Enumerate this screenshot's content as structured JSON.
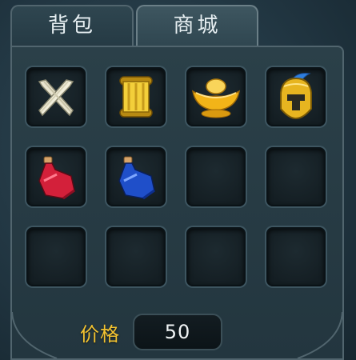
{
  "tabs": [
    {
      "label": "背包",
      "active": false
    },
    {
      "label": "商城",
      "active": true
    }
  ],
  "grid": {
    "slots": [
      {
        "item": "crossed-swords-icon"
      },
      {
        "item": "scroll-icon"
      },
      {
        "item": "gold-ingot-icon"
      },
      {
        "item": "helmet-icon"
      },
      {
        "item": "red-potion-icon"
      },
      {
        "item": "blue-potion-icon"
      },
      {
        "item": ""
      },
      {
        "item": ""
      },
      {
        "item": ""
      },
      {
        "item": ""
      },
      {
        "item": ""
      },
      {
        "item": ""
      }
    ]
  },
  "price": {
    "label": "价格",
    "value": "50"
  },
  "colors": {
    "price_label": "#f2c230",
    "panel_border": "#51656e",
    "background": "#223743"
  }
}
